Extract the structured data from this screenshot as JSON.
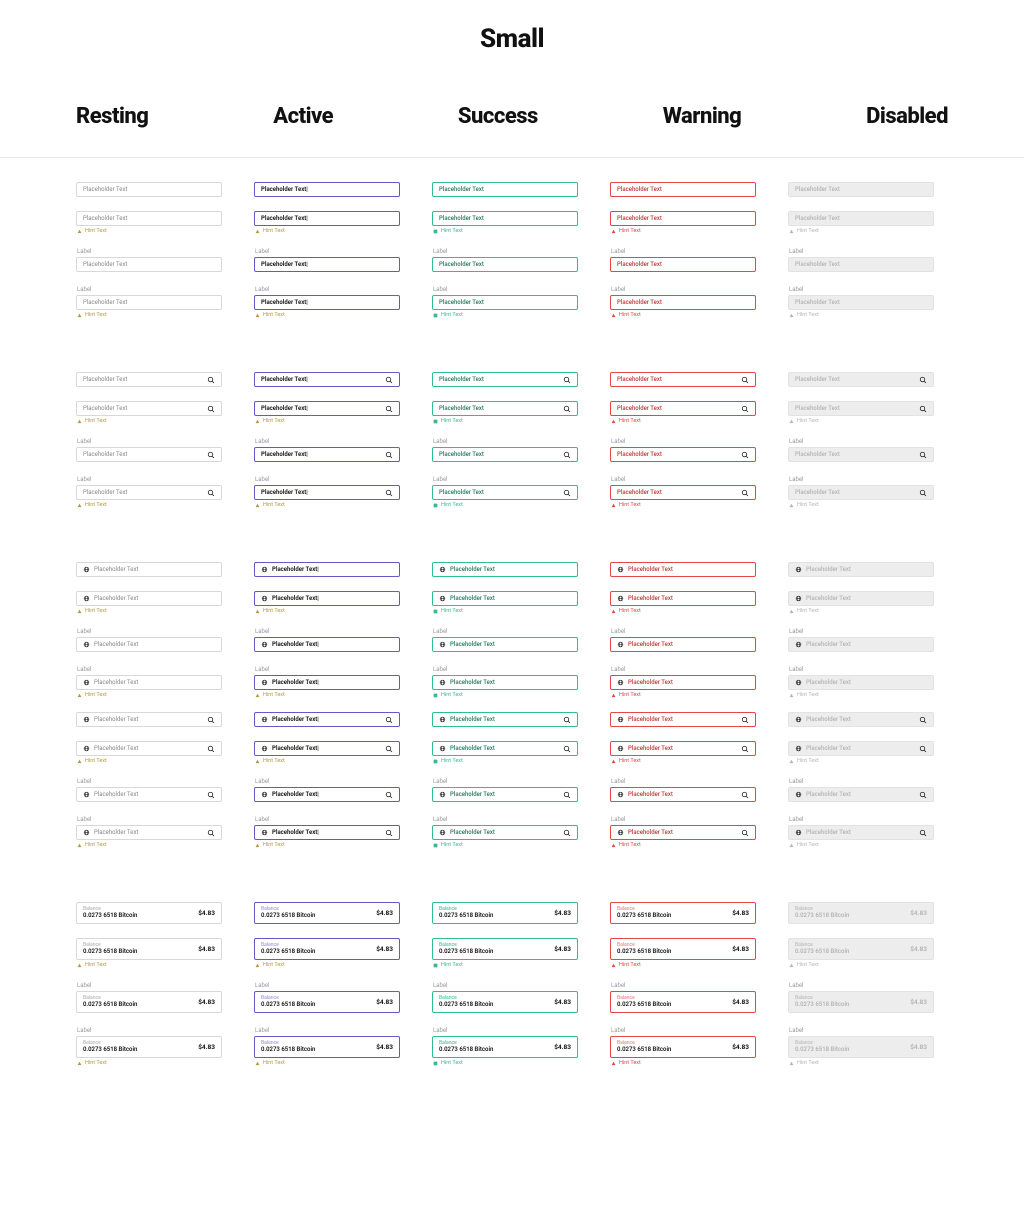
{
  "title": "Small",
  "states": [
    "Resting",
    "Active",
    "Success",
    "Warning",
    "Disabled"
  ],
  "placeholder": "Placeholder Text",
  "placeholder_active": "Placeholder Text|",
  "label": "Label",
  "hint": "Hint Text",
  "balance_label": "Balance",
  "balance_value": "0.0273 6518 Bitcoin",
  "balance_price": "$4.83",
  "colors": {
    "resting": "#d8d8d8",
    "active": "#6b56c8",
    "success": "#2fbf8d",
    "warning": "#e34848",
    "disabled_bg": "#ededed",
    "disabled_text": "#b5b5b5",
    "hint_default": "#b39a3a"
  }
}
